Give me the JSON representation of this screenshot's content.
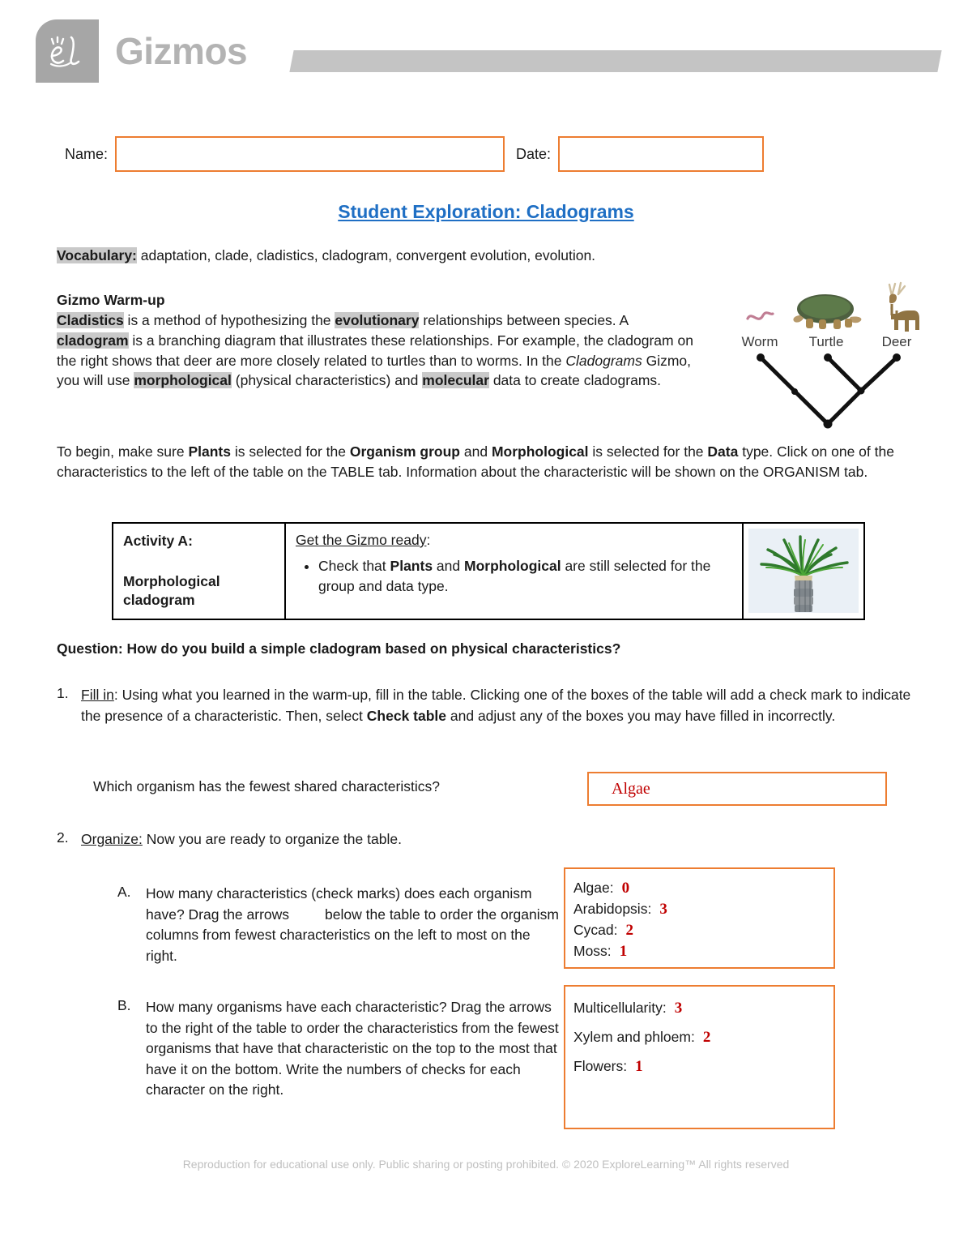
{
  "header": {
    "logo_word": "Gizmos",
    "logo_mark_name": "el-monogram-icon"
  },
  "namedate": {
    "name_label": "Name:",
    "name_value": "",
    "date_label": "Date:",
    "date_value": ""
  },
  "title": "Student Exploration: Cladograms",
  "vocabulary": {
    "label": "Vocabulary:",
    "terms": " adaptation, clade, cladistics, cladogram, convergent evolution, evolution."
  },
  "warmup": {
    "heading": "Gizmo Warm-up",
    "seg1": "Cladistics",
    "seg2": " is a method of hypothesizing the ",
    "seg3": "evolutionary",
    "seg4": " relationships between species. A ",
    "seg5": "cladogram",
    "seg6": " is a branching diagram that illustrates these relationships. For example, the cladogram on the right shows that deer are more closely related to turtles than to worms. In the ",
    "seg7": "Cladograms",
    "seg8": " Gizmo, you will use ",
    "seg9": "morphological",
    "seg10": " (physical characteristics) and ",
    "seg11": "molecular",
    "seg12": " data to create cladograms."
  },
  "cladogram_figure": {
    "labels": [
      "Worm",
      "Turtle",
      "Deer"
    ]
  },
  "tobegin": {
    "seg1": "To begin, make sure ",
    "seg2": "Plants",
    "seg3": " is selected for the ",
    "seg4": "Organism group",
    "seg5": " and ",
    "seg6": "Morphological",
    "seg7": " is selected for the ",
    "seg8": "Data",
    "seg9": " type. Click on one of the characteristics to the left of the table on the TABLE tab. Information about the characteristic will be shown on the ORGANISM tab."
  },
  "activity": {
    "left_title": "Activity A:",
    "left_sub": "Morphological cladogram",
    "ready_label": "Get the Gizmo ready",
    "ready_colon": ":",
    "bullet_seg1": "Check that ",
    "bullet_seg2": "Plants",
    "bullet_seg3": " and ",
    "bullet_seg4": "Morphological",
    "bullet_seg5": " are still selected for the group and data type.",
    "image_name": "cycad-plant-image"
  },
  "question": "Question: How do you build a simple cladogram based on physical characteristics?",
  "item1": {
    "number": "1.",
    "lead": "Fill in",
    "text": ": Using what you learned in the warm-up, fill in the table. Clicking one of the boxes of the table will add a check mark to indicate the presence of a characteristic. Then, select ",
    "bold_term": "Check table",
    "text2": " and adjust any of the boxes you may have filled in incorrectly."
  },
  "fewest_question": {
    "prompt": "Which organism has the fewest shared characteristics?",
    "answer": "Algae"
  },
  "item2": {
    "number": "2.",
    "lead": "Organize:",
    "text": " Now you are ready to organize the table."
  },
  "sub_a": {
    "letter": "A.",
    "text1": "How many characteristics (check marks) does each organism have? Drag the arrows",
    "text2": "below the table to order the organism columns from fewest characteristics on the left to most on the right.",
    "answers": [
      {
        "label": "Algae:",
        "value": "0"
      },
      {
        "label": "Arabidopsis:",
        "value": "3"
      },
      {
        "label": "Cycad:",
        "value": "2"
      },
      {
        "label": "Moss:",
        "value": "1"
      }
    ]
  },
  "sub_b": {
    "letter": "B.",
    "text": "How many organisms have each characteristic? Drag the arrows to the right of the table to order the characteristics from the fewest organisms that have that characteristic on the top to the most that have it on the bottom. Write the numbers of checks for each character on the right.",
    "answers": [
      {
        "label": "Multicellularity:",
        "value": "3"
      },
      {
        "label": "Xylem and phloem:",
        "value": "2"
      },
      {
        "label": "Flowers:",
        "value": "1"
      }
    ]
  },
  "footer": "Reproduction for educational use only. Public sharing or posting prohibited. © 2020 ExploreLearning™ All rights reserved",
  "colors": {
    "accent_orange": "#ED7D31",
    "title_blue": "#1F6FC4",
    "answer_red": "#C00000",
    "logo_gray": "#a6a6a6",
    "highlight_gray": "#c9c9c9"
  }
}
